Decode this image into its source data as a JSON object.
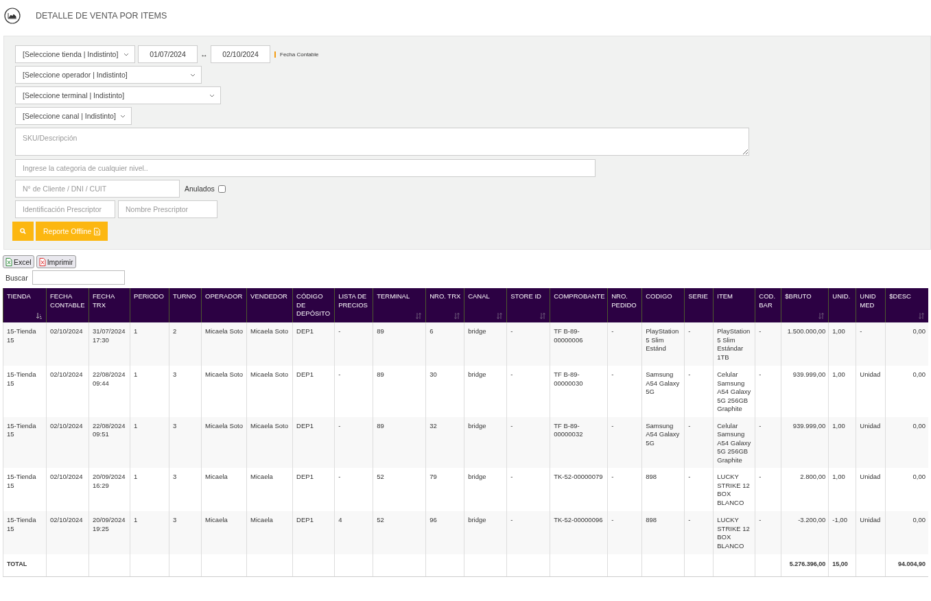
{
  "header": {
    "title": "DETALLE DE VENTA POR ITEMS"
  },
  "filters": {
    "store_select": "[Seleccione tienda | Indistinto]",
    "date_from": "01/07/2024",
    "date_separator": "↔",
    "date_to": "02/10/2024",
    "date_type_label": "Fecha Contable",
    "operator_select": "[Seleccione operador | Indistinto]",
    "terminal_select": "[Seleccione terminal | Indistinto]",
    "channel_select": "[Seleccione canal | Indistinto]",
    "sku": {
      "placeholder": "SKU/Descripción"
    },
    "category": {
      "placeholder": "Ingrese la categoria de cualquier nivel.."
    },
    "client": {
      "placeholder": "N° de Cliente / DNI / CUIT"
    },
    "annulled": {
      "label": "Anulados",
      "checked": false
    },
    "prescriber_id": {
      "placeholder": "Identificación Prescriptor"
    },
    "prescriber_name": {
      "placeholder": "Nombre Prescriptor"
    },
    "offline_button": "Reporte Offline"
  },
  "export_buttons": [
    {
      "label": "Excel",
      "kind": "excel"
    },
    {
      "label": "Imprimir",
      "kind": "pdf"
    }
  ],
  "search": {
    "label": "Buscar"
  },
  "table": {
    "columns": [
      {
        "label": "TIENDA",
        "sortable": true,
        "sorted": true
      },
      {
        "label": "FECHA CONTABLE",
        "sortable": false
      },
      {
        "label": "FECHA TRX",
        "sortable": false
      },
      {
        "label": "PERIODO",
        "sortable": false
      },
      {
        "label": "TURNO",
        "sortable": false
      },
      {
        "label": "OPERADOR",
        "sortable": false
      },
      {
        "label": "VENDEDOR",
        "sortable": false
      },
      {
        "label": "CÓDIGO DE DEPÓSITO",
        "sortable": false
      },
      {
        "label": "LISTA DE PRECIOS",
        "sortable": false
      },
      {
        "label": "TERMINAL",
        "sortable": true,
        "sorted": false
      },
      {
        "label": "NRO. TRX",
        "sortable": true,
        "sorted": false
      },
      {
        "label": "CANAL",
        "sortable": true,
        "sorted": false
      },
      {
        "label": "STORE ID",
        "sortable": true,
        "sorted": false
      },
      {
        "label": "COMPROBANTE",
        "sortable": false
      },
      {
        "label": "NRO. PEDIDO",
        "sortable": false
      },
      {
        "label": "CODIGO",
        "sortable": false
      },
      {
        "label": "SERIE",
        "sortable": false
      },
      {
        "label": "ITEM",
        "sortable": false
      },
      {
        "label": "COD. BAR",
        "sortable": false
      },
      {
        "label": "$BRUTO",
        "sortable": true,
        "sorted": false,
        "kind": "amount"
      },
      {
        "label": "UNID.",
        "sortable": false
      },
      {
        "label": "UNID MED",
        "sortable": false
      },
      {
        "label": "$DESC",
        "sortable": true,
        "sorted": false,
        "kind": "amount"
      }
    ],
    "rows": [
      [
        "15-Tienda 15",
        "02/10/2024",
        "31/07/2024 17:30",
        "1",
        "2",
        "Micaela Soto",
        "Micaela Soto",
        "DEP1",
        "-",
        "89",
        "6",
        "bridge",
        "-",
        "TF B-89-00000006",
        "-",
        "PlayStation 5 Slim Estánd",
        "-",
        "PlayStation 5 Slim Estándar 1TB",
        "-",
        "1.500.000,00",
        "1,00",
        "-",
        "0,00"
      ],
      [
        "15-Tienda 15",
        "02/10/2024",
        "22/08/2024 09:44",
        "1",
        "3",
        "Micaela Soto",
        "Micaela Soto",
        "DEP1",
        "-",
        "89",
        "30",
        "bridge",
        "-",
        "TF B-89-00000030",
        "-",
        "Samsung A54 Galaxy 5G",
        "-",
        "Celular Samsung A54 Galaxy 5G 256GB Graphite",
        "-",
        "939.999,00",
        "1,00",
        "Unidad",
        "0,00"
      ],
      [
        "15-Tienda 15",
        "02/10/2024",
        "22/08/2024 09:51",
        "1",
        "3",
        "Micaela Soto",
        "Micaela Soto",
        "DEP1",
        "-",
        "89",
        "32",
        "bridge",
        "-",
        "TF B-89-00000032",
        "-",
        "Samsung A54 Galaxy 5G",
        "-",
        "Celular Samsung A54 Galaxy 5G 256GB Graphite",
        "-",
        "939.999,00",
        "1,00",
        "Unidad",
        "0,00"
      ],
      [
        "15-Tienda 15",
        "02/10/2024",
        "20/09/2024 16:29",
        "1",
        "3",
        "Micaela",
        "Micaela",
        "DEP1",
        "-",
        "52",
        "79",
        "bridge",
        "-",
        "TK-52-00000079",
        "-",
        "898",
        "-",
        "LUCKY STRIKE 12 BOX BLANCO",
        "-",
        "2.800,00",
        "1,00",
        "Unidad",
        "0,00"
      ],
      [
        "15-Tienda 15",
        "02/10/2024",
        "20/09/2024 19:25",
        "1",
        "3",
        "Micaela",
        "Micaela",
        "DEP1",
        "4",
        "52",
        "96",
        "bridge",
        "-",
        "TK-52-00000096",
        "-",
        "898",
        "-",
        "LUCKY STRIKE 12 BOX BLANCO",
        "-",
        "-3.200,00",
        "-1,00",
        "Unidad",
        "0,00"
      ]
    ],
    "footer": {
      "label": "TOTAL",
      "bruto": "5.276.396,00",
      "units": "15,00",
      "discount": "94.004,90"
    }
  }
}
